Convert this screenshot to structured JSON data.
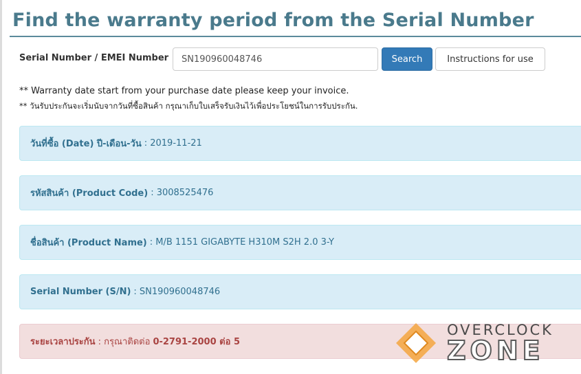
{
  "page": {
    "title": "Find the warranty period from the Serial Number"
  },
  "search": {
    "label": "Serial Number / EMEI Number :",
    "value": "SN190960048746",
    "search_button": "Search",
    "instructions_button": "Instructions for use"
  },
  "notices": [
    "** Warranty date start from your purchase date please keep your invoice.",
    "** วันรับประกันจะเริ่มนับจากวันที่ซื้อสินค้า กรุณาเก็บใบเสร็จรับเงินไว้เพื่อประโยชน์ในการรับประกัน."
  ],
  "results": [
    {
      "label": "วันที่ซื้อ (Date) ปี-เดือน-วัน",
      "value": ": 2019-11-21"
    },
    {
      "label": "รหัสสินค้า (Product Code)",
      "value": ": 3008525476"
    },
    {
      "label": "ชื่อสินค้า (Product Name)",
      "value": ": M/B 1151 GIGABYTE H310M S2H 2.0 3-Y"
    },
    {
      "label": "Serial Number (S/N)",
      "value": ": SN190960048746"
    }
  ],
  "warranty": {
    "label": "ระยะเวลาประกัน",
    "prefix": ": กรุณาติดต่อ",
    "contact": "0-2791-2000 ต่อ 5"
  },
  "watermark": {
    "line1": "OVERCLOCK",
    "line2": "ZONE",
    "colors": {
      "orange": "#f5a640",
      "gray": "#5a5a5a"
    }
  },
  "colors": {
    "title": "#4a7a8c",
    "primary_button": "#337ab7",
    "info_bg": "#d9edf7",
    "info_text": "#31708f",
    "danger_bg": "#f2dede",
    "danger_text": "#a94442"
  }
}
